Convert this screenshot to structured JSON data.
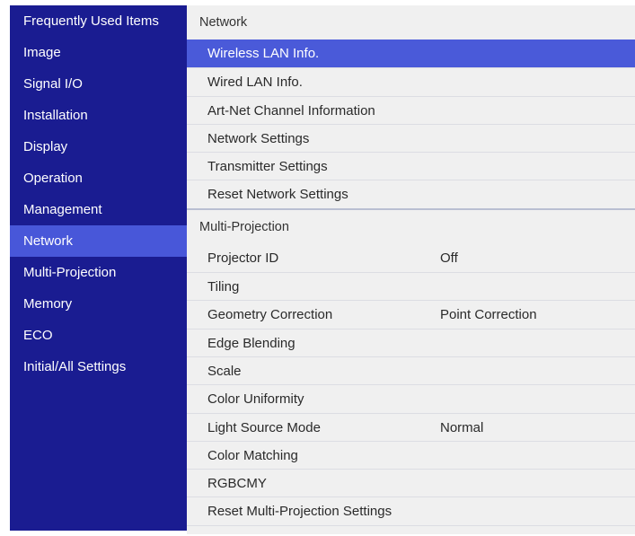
{
  "sidebar": {
    "items": [
      {
        "label": "Frequently Used Items"
      },
      {
        "label": "Image"
      },
      {
        "label": "Signal I/O"
      },
      {
        "label": "Installation"
      },
      {
        "label": "Display"
      },
      {
        "label": "Operation"
      },
      {
        "label": "Management"
      },
      {
        "label": "Network",
        "active": true
      },
      {
        "label": "Multi-Projection"
      },
      {
        "label": "Memory"
      },
      {
        "label": "ECO"
      },
      {
        "label": "Initial/All Settings"
      }
    ]
  },
  "colors": {
    "sidebar_bg": "#1a1c91",
    "highlight": "#4a5ad9",
    "panel_bg": "#f0f0f0"
  },
  "main": {
    "network": {
      "header": "Network",
      "rows": [
        {
          "label": "Wireless LAN Info.",
          "selected": true
        },
        {
          "label": "Wired LAN Info."
        },
        {
          "label": "Art-Net Channel Information"
        },
        {
          "label": "Network Settings"
        },
        {
          "label": "Transmitter Settings"
        },
        {
          "label": "Reset Network Settings"
        }
      ]
    },
    "multi_projection": {
      "header": "Multi-Projection",
      "rows": [
        {
          "label": "Projector ID",
          "value": "Off"
        },
        {
          "label": "Tiling"
        },
        {
          "label": "Geometry Correction",
          "value": "Point Correction"
        },
        {
          "label": "Edge Blending"
        },
        {
          "label": "Scale"
        },
        {
          "label": "Color Uniformity"
        },
        {
          "label": "Light Source Mode",
          "value": "Normal"
        },
        {
          "label": "Color Matching"
        },
        {
          "label": "RGBCMY"
        },
        {
          "label": "Reset Multi-Projection Settings"
        }
      ]
    }
  }
}
